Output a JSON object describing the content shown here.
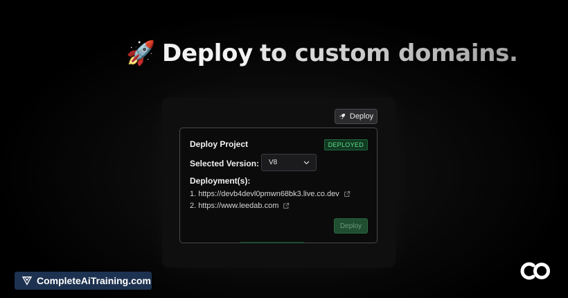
{
  "headline": {
    "emoji": "🚀",
    "text_part1": "Deploy",
    "text_part2": "to custom domains."
  },
  "toolbar": {
    "deploy_label": "Deploy",
    "deploy_icon": "rocket-icon"
  },
  "dialog": {
    "title": "Deploy Project",
    "status_badge": "DEPLOYED",
    "selected_version_label": "Selected Version:",
    "selected_version_value": "V8",
    "deployments_label": "Deployment(s):",
    "deployments": [
      {
        "index": "1.",
        "url": "https://devb4devl0pmwn68bk3.live.co.dev"
      },
      {
        "index": "2.",
        "url": "https://www.leedab.com"
      }
    ],
    "deploy_button_label": "Deploy"
  },
  "footer": {
    "brand_text": "CompleteAiTraining.com",
    "brand_icon": "triangle-logo-icon",
    "corner_logo": "co-logo"
  },
  "colors": {
    "background": "#000000",
    "badge_bg": "#123a22",
    "badge_text": "#5ee08c",
    "deploy_button_bg": "#1f4e30",
    "brand_bg": "#1d3250"
  }
}
